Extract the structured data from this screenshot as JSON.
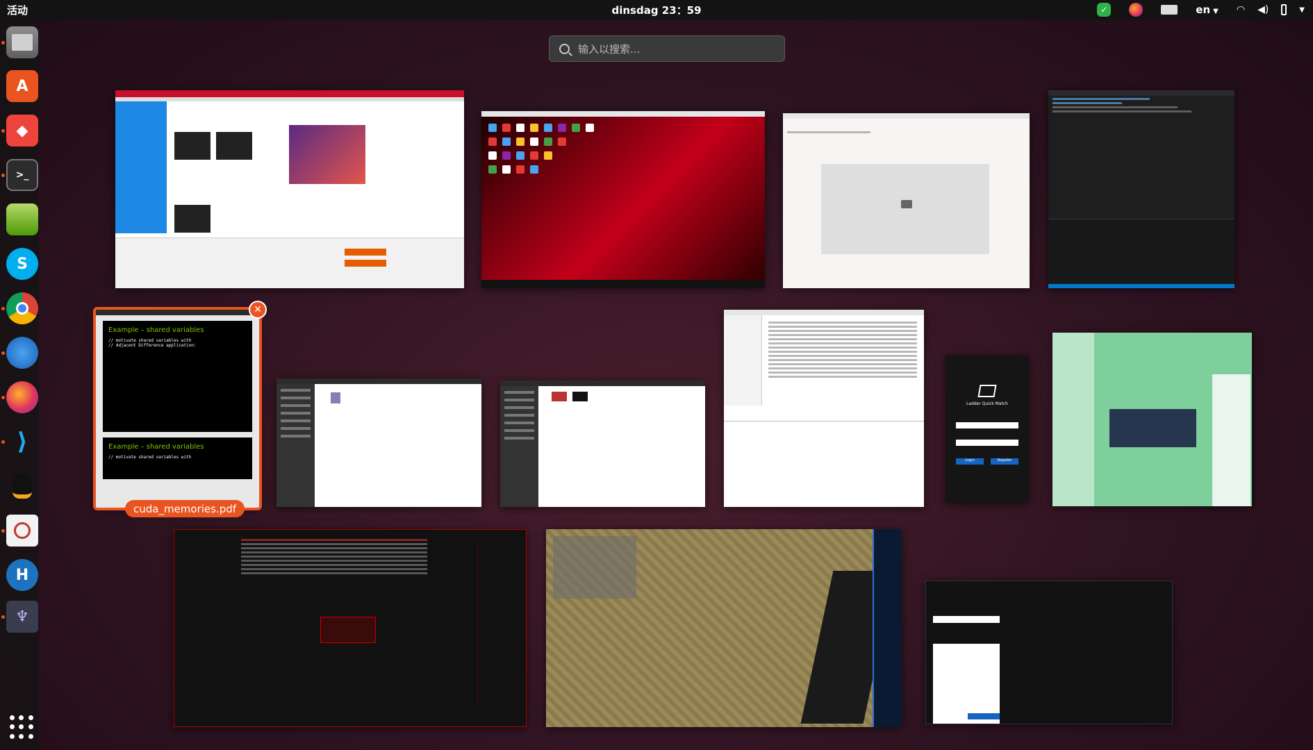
{
  "topbar": {
    "activities": "活动",
    "clock": "dinsdag 23：59",
    "language": "en"
  },
  "search": {
    "placeholder": "输入以搜索..."
  },
  "dock": {
    "items": [
      {
        "name": "files"
      },
      {
        "name": "software-store"
      },
      {
        "name": "anydesk"
      },
      {
        "name": "terminal"
      },
      {
        "name": "text-editor"
      },
      {
        "name": "skype"
      },
      {
        "name": "chrome"
      },
      {
        "name": "thunderbird"
      },
      {
        "name": "firefox"
      },
      {
        "name": "vscode"
      },
      {
        "name": "qq"
      },
      {
        "name": "document-viewer"
      },
      {
        "name": "h-app"
      },
      {
        "name": "ladder-app"
      }
    ]
  },
  "windows": {
    "selected_label": "cuda_memories.pdf",
    "nv_title1": "Example – shared variables",
    "nv_title2": "Example – shared variables",
    "nv_code1": "// motivate shared variables with",
    "nv_code2": "// Adjacent Difference application:",
    "ladder_title": "Ladder Quick Match",
    "ladder_login": "Login",
    "ladder_register": "Register"
  }
}
